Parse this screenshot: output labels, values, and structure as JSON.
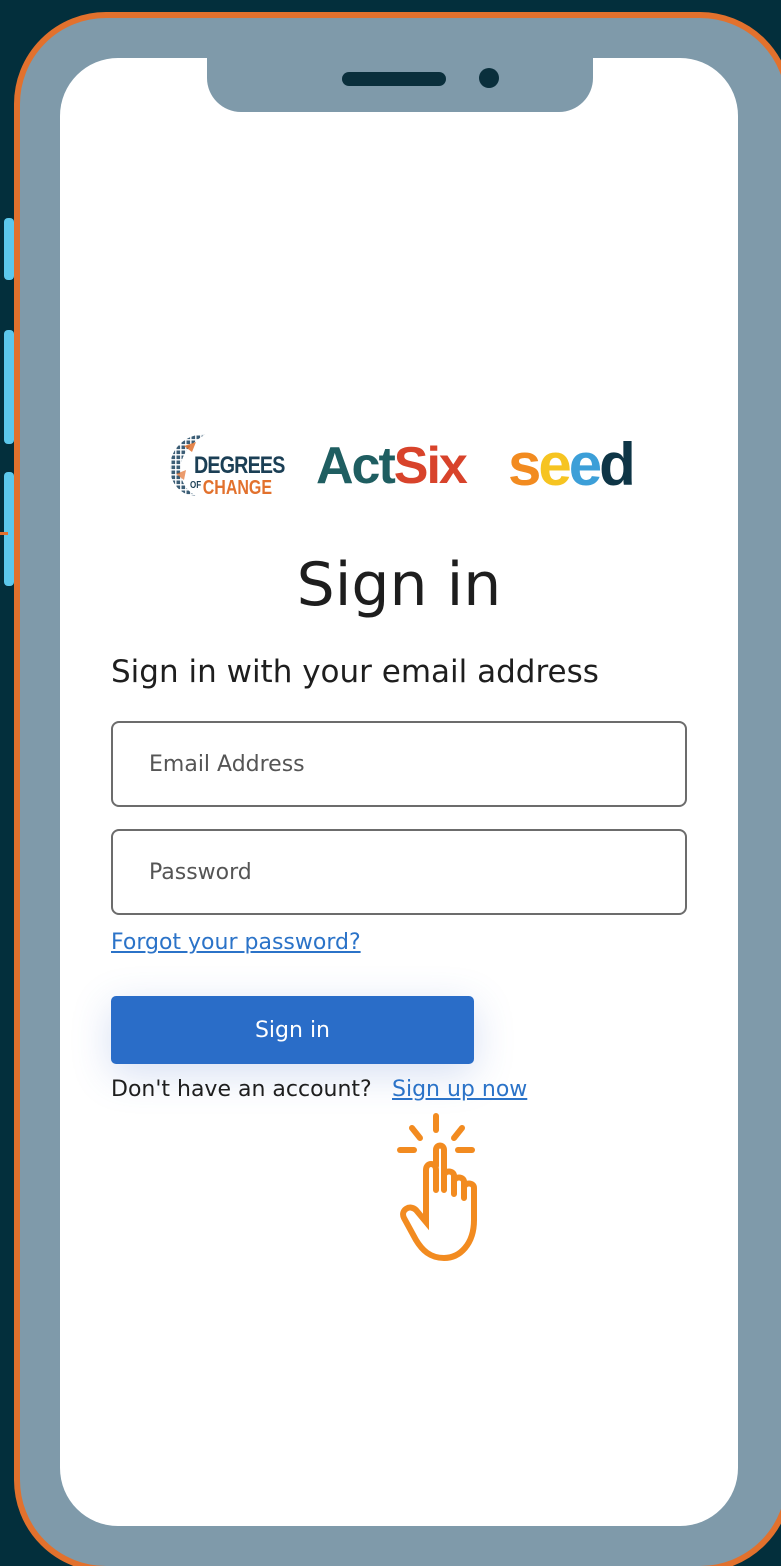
{
  "logos": {
    "degrees_line1": "DEGREES",
    "degrees_of": "OF",
    "degrees_line2": "CHANGE",
    "actsix_act": "Act",
    "actsix_six": "Six",
    "seed_s": "s",
    "seed_e1": "e",
    "seed_e2": "e",
    "seed_d": "d"
  },
  "form": {
    "title": "Sign in",
    "subtitle": "Sign in with your email address",
    "email_placeholder": "Email Address",
    "password_placeholder": "Password",
    "forgot_link": "Forgot your password?",
    "submit_label": "Sign in",
    "no_account_text": "Don't have an account?",
    "signup_link": "Sign up now"
  },
  "colors": {
    "background": "#032f3c",
    "phone_frame": "#7f9aaa",
    "phone_border": "#e2712d",
    "button": "#2a6dc8",
    "link": "#2b73c8",
    "pointer_hand": "#f28b20"
  },
  "icons": {
    "pointer": "tap-hand-icon"
  }
}
